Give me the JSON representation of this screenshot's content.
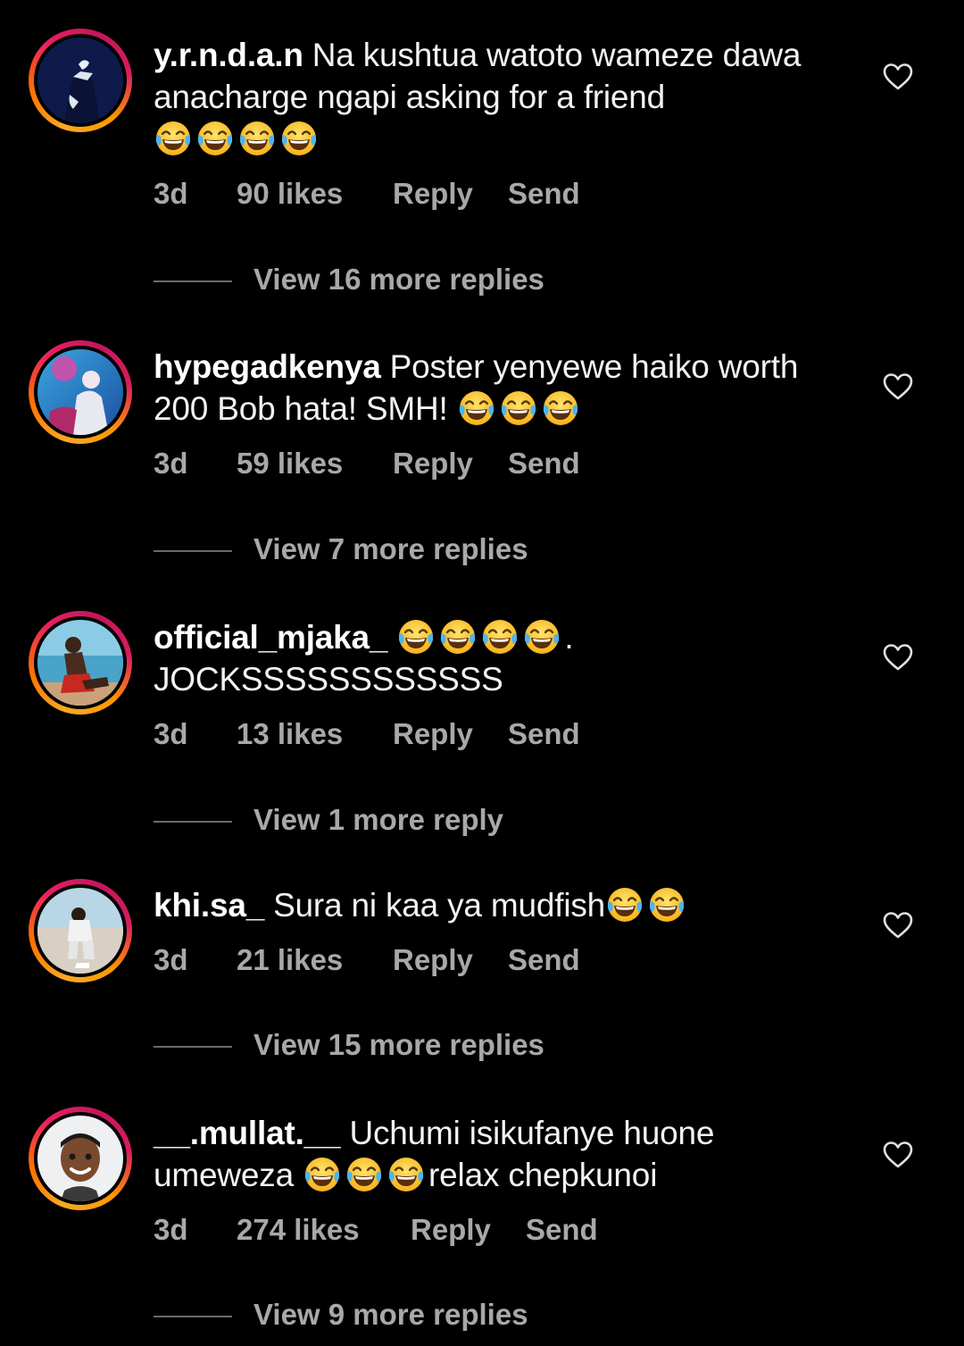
{
  "colors": {
    "background": "#000000",
    "text": "#f5f5f5",
    "muted": "#a8a8a8",
    "ring_gradient": [
      "#f9a825",
      "#e91e63",
      "#c2185b"
    ]
  },
  "comments": [
    {
      "username": "y.r.n.d.a.n",
      "text": "Na kushtua watoto wameze dawa anacharge ngapi asking for a friend",
      "emojis": [
        "face-with-tears-of-joy",
        "face-with-tears-of-joy",
        "face-with-tears-of-joy",
        "face-with-tears-of-joy"
      ],
      "time": "3d",
      "likes": "90 likes",
      "reply": "Reply",
      "send": "Send",
      "view_replies": "View 16 more replies"
    },
    {
      "username": "hypegadkenya",
      "text": "Poster yenyewe haiko worth 200 Bob hata! SMH!",
      "emojis": [
        "face-with-tears-of-joy",
        "face-with-tears-of-joy",
        "face-with-tears-of-joy"
      ],
      "time": "3d",
      "likes": "59 likes",
      "reply": "Reply",
      "send": "Send",
      "view_replies": "View 7 more replies"
    },
    {
      "username": "official_mjaka_",
      "text_after_emojis": ".",
      "text_line2": "JOCKSSSSSSSSSSSS",
      "emojis": [
        "face-with-tears-of-joy",
        "face-with-tears-of-joy",
        "face-with-tears-of-joy",
        "face-with-tears-of-joy"
      ],
      "time": "3d",
      "likes": "13 likes",
      "reply": "Reply",
      "send": "Send",
      "view_replies": "View 1 more reply"
    },
    {
      "username": "khi.sa_",
      "text": "Sura ni kaa ya mudfish",
      "emojis": [
        "face-with-tears-of-joy",
        "face-with-tears-of-joy"
      ],
      "time": "3d",
      "likes": "21 likes",
      "reply": "Reply",
      "send": "Send",
      "view_replies": "View 15 more replies"
    },
    {
      "username": "__.mullat.__",
      "text": "Uchumi isikufanye huone umeweza",
      "emojis": [
        "face-with-tears-of-joy",
        "face-with-tears-of-joy",
        "face-with-tears-of-joy"
      ],
      "text_after_emojis": "relax chepkunoi",
      "time": "3d",
      "likes": "274 likes",
      "reply": "Reply",
      "send": "Send",
      "view_replies": "View 9 more replies"
    }
  ]
}
